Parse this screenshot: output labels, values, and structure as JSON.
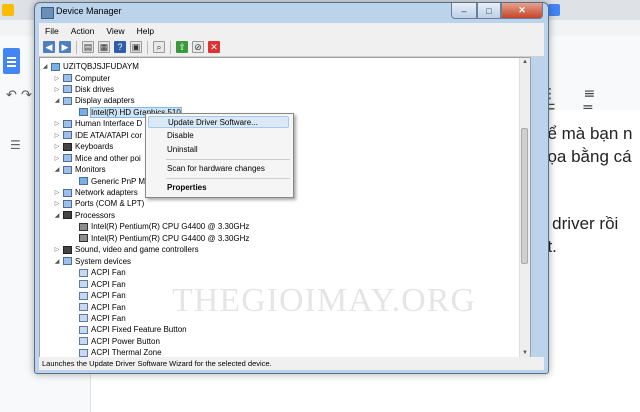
{
  "window": {
    "title": "Device Manager",
    "buttons": {
      "minimize": "–",
      "maximize": "□",
      "close": "✕"
    }
  },
  "menubar": [
    "File",
    "Action",
    "View",
    "Help"
  ],
  "tree": {
    "root": "UZITQBJSJFUDAYM",
    "items": [
      {
        "label": "Computer",
        "level": 1,
        "expander": "▷"
      },
      {
        "label": "Disk drives",
        "level": 1,
        "expander": "▷"
      },
      {
        "label": "Display adapters",
        "level": 1,
        "expander": "◢"
      },
      {
        "label": "Intel(R) HD Graphics 510",
        "level": 2,
        "expander": ""
      },
      {
        "label": "Human Interface D",
        "level": 1,
        "expander": "▷"
      },
      {
        "label": "IDE ATA/ATAPI cor",
        "level": 1,
        "expander": "▷"
      },
      {
        "label": "Keyboards",
        "level": 1,
        "expander": "▷"
      },
      {
        "label": "Mice and other poi",
        "level": 1,
        "expander": "▷"
      },
      {
        "label": "Monitors",
        "level": 1,
        "expander": "◢"
      },
      {
        "label": "Generic PnP Mo",
        "level": 2,
        "expander": ""
      },
      {
        "label": "Network adapters",
        "level": 1,
        "expander": "▷"
      },
      {
        "label": "Ports (COM & LPT)",
        "level": 1,
        "expander": "▷"
      },
      {
        "label": "Processors",
        "level": 1,
        "expander": "◢"
      },
      {
        "label": "Intel(R) Pentium(R) CPU G4400 @ 3.30GHz",
        "level": 2,
        "expander": ""
      },
      {
        "label": "Intel(R) Pentium(R) CPU G4400 @ 3.30GHz",
        "level": 2,
        "expander": ""
      },
      {
        "label": "Sound, video and game controllers",
        "level": 1,
        "expander": "▷"
      },
      {
        "label": "System devices",
        "level": 1,
        "expander": "◢"
      },
      {
        "label": "ACPI Fan",
        "level": 2,
        "expander": ""
      },
      {
        "label": "ACPI Fan",
        "level": 2,
        "expander": ""
      },
      {
        "label": "ACPI Fan",
        "level": 2,
        "expander": ""
      },
      {
        "label": "ACPI Fan",
        "level": 2,
        "expander": ""
      },
      {
        "label": "ACPI Fan",
        "level": 2,
        "expander": ""
      },
      {
        "label": "ACPI Fixed Feature Button",
        "level": 2,
        "expander": ""
      },
      {
        "label": "ACPI Power Button",
        "level": 2,
        "expander": ""
      },
      {
        "label": "ACPI Thermal Zone",
        "level": 2,
        "expander": ""
      }
    ]
  },
  "context_menu": {
    "update": "Update Driver Software...",
    "disable": "Disable",
    "uninstall": "Uninstall",
    "scan": "Scan for hardware changes",
    "properties": "Properties"
  },
  "statusbar": "Launches the Update Driver Software Wizard for the selected device.",
  "background_doc": {
    "line1": "hể mà bạn n",
    "line2": "họa bằng cá",
    "line3": "e driver rồi",
    "line4": "ật."
  },
  "watermark": "THEGIOIMAY.ORG",
  "colors": {
    "accent": "#4285f4",
    "selection": "#cde4f7"
  }
}
